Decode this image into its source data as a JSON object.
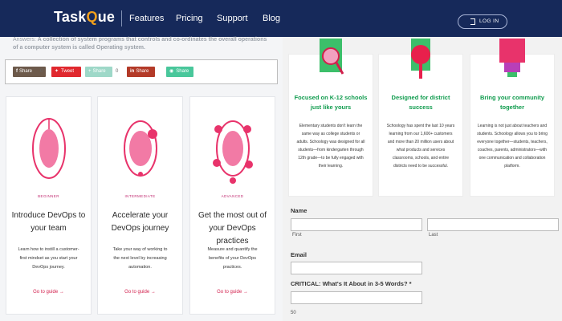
{
  "header": {
    "logo_task": "Task",
    "logo_q": "Q",
    "logo_ue": "ue",
    "nav": [
      "Features",
      "Pricing",
      "Support",
      "Blog"
    ],
    "login": "LOG IN",
    "colors": {
      "bar": "#16295a",
      "accent": "#f2a01c"
    }
  },
  "answer": {
    "prefix": "Answers: ",
    "text": "A collection of system programs that controls and co-ordinates the overall operations of a computer system is called Operating system."
  },
  "share": [
    {
      "label": "Share",
      "icon": "f",
      "count": "0",
      "color": "#6d5a4b"
    },
    {
      "label": "Tweet",
      "icon": "bird",
      "count": "",
      "color": "#e0282e"
    },
    {
      "label": "Share",
      "icon": "plus",
      "count": "0",
      "color": "#9ed8c8"
    },
    {
      "label": "Share",
      "icon": "in",
      "count": "",
      "color": "#b33a28"
    },
    {
      "label": "Share",
      "icon": "whatsapp",
      "count": "",
      "color": "#49c79b"
    }
  ],
  "devops_cards": [
    {
      "level": "BEGINNER",
      "title": "Introduce DevOps to your team",
      "desc": "Learn how to instill a customer-first mindset as you start your DevOps journey.",
      "link": "Go to guide →"
    },
    {
      "level": "INTERMEDIATE",
      "title": "Accelerate your DevOps journey",
      "desc": "Take your way of working to the next level by increasing automation.",
      "link": "Go to guide →"
    },
    {
      "level": "ADVANCED",
      "title": "Get the most out of your DevOps practices",
      "desc": "Measure and quantify the benefits of your DevOps practices.",
      "link": "Go to guide →"
    }
  ],
  "features": [
    {
      "title": "Focused on K-12 schools just like yours",
      "desc": "Elementary students don't learn the same way as college students or adults. Schoology was designed for all students—from kindergarten through 12th grade—to be fully engaged with their learning."
    },
    {
      "title": "Designed for district success",
      "desc": "Schoology has spent the last 10 years learning from our 1,600+ customers and more than 20 million users about what products and services classrooms, schools, and entire districts need to be successful."
    },
    {
      "title": "Bring your community together",
      "desc": "Learning is not just about teachers and students. Schoology allows you to bring everyone together—students, teachers, coaches, parents, administrators—with one communication and collaboration platform."
    }
  ],
  "form": {
    "name_label": "Name",
    "first_label": "First",
    "last_label": "Last",
    "email_label": "Email",
    "critical_label": "CRITICAL: What's It About in 3-5 Words? *",
    "counter": "50"
  }
}
